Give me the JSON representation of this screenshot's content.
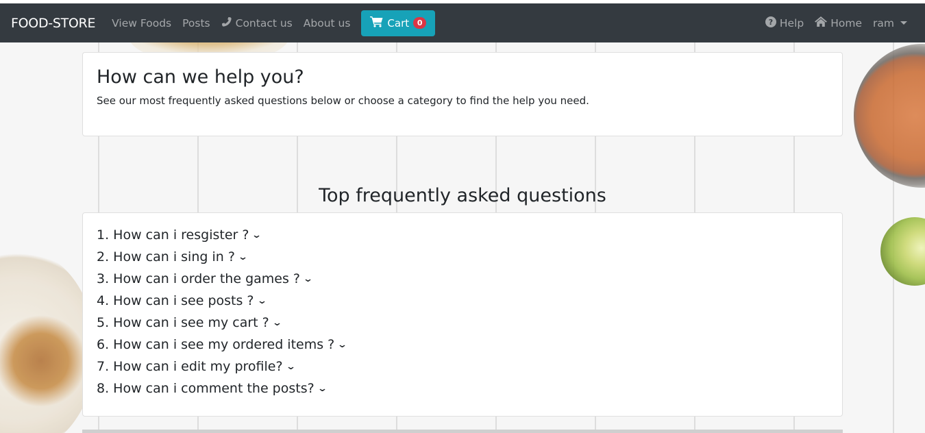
{
  "navbar": {
    "brand": "FOOD-STORE",
    "links": [
      "View Foods",
      "Posts",
      "Contact us",
      "About us"
    ],
    "contact_icon": "phone-icon",
    "cart": {
      "label": "Cart",
      "count": "0",
      "icon": "cart-icon"
    },
    "right": {
      "help": "Help",
      "help_icon": "question-circle-icon",
      "home": "Home",
      "home_icon": "home-icon",
      "user": "ram"
    }
  },
  "help_card": {
    "title": "How can we help you?",
    "subtitle": "See our most frequently asked questions below or choose a category to find the help you need."
  },
  "faq": {
    "heading": "Top frequently asked questions",
    "items": [
      "1. How can i resgister ?",
      "2. How can i sing in ?",
      "3. How can i order the games ?",
      "4. How can i see posts ?",
      "5. How can i see my cart ?",
      "6. How can i see my ordered items ?",
      "7. How can i edit my profile?",
      "8. How can i comment the posts?"
    ]
  },
  "colors": {
    "navbar_bg": "#343a40",
    "cart_button": "#17a2b8",
    "badge": "#dc3545"
  }
}
